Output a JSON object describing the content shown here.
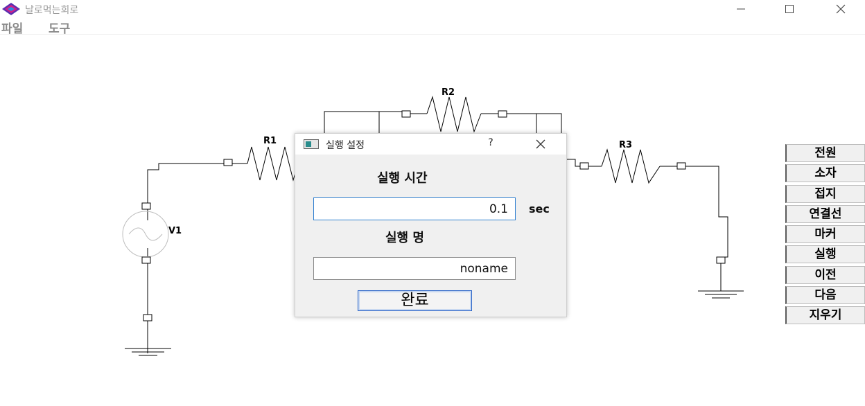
{
  "app": {
    "title": "날로먹는회로",
    "icon": "app-diamond-icon"
  },
  "window_controls": {
    "minimize": "minimize-icon",
    "maximize": "maximize-icon",
    "close": "close-icon"
  },
  "menu": {
    "file": "파일",
    "tools": "도구"
  },
  "schematic": {
    "labels": {
      "r1": "R1",
      "r2": "R2",
      "r3": "R3",
      "v1": "V1"
    }
  },
  "tool_panel": {
    "buttons": [
      "전원",
      "소자",
      "접지",
      "연결선",
      "마커",
      "실행",
      "이전",
      "다음",
      "지우기"
    ]
  },
  "dialog": {
    "title": "실행 설정",
    "help": "?",
    "time_heading": "실행 시간",
    "time_value": "0.1",
    "time_unit": "sec",
    "name_heading": "실행 명",
    "name_value": "noname",
    "ok_label": "완료"
  },
  "colors": {
    "accent_blue": "#2f7fd0",
    "icon_purple": "#5b2fb0",
    "icon_magenta": "#d0208a"
  }
}
